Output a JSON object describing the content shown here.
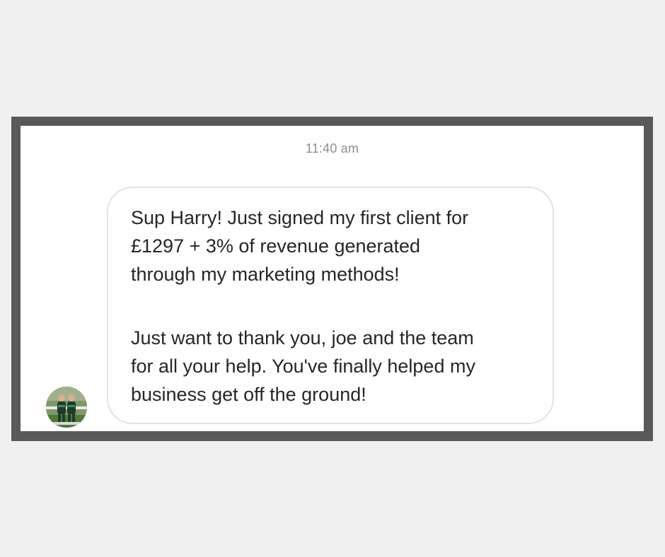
{
  "conversation": {
    "timestamp": "11:40 am",
    "message": {
      "paragraphs": [
        "Sup Harry! Just signed my first client for\n£1297 + 3% of revenue generated\nthrough my marketing methods!",
        "Just want to thank you, joe and the team\nfor all your help. You've finally helped my\nbusiness get off the ground!"
      ]
    },
    "sender": {
      "avatar_icon": "profile-photo-icon"
    }
  },
  "colors": {
    "page_background": "#eff0ef",
    "frame_border": "#595959",
    "screen_background": "#ffffff",
    "bubble_border": "#e3e3e3",
    "message_text": "#262626",
    "timestamp_text": "#8e8e8e"
  }
}
